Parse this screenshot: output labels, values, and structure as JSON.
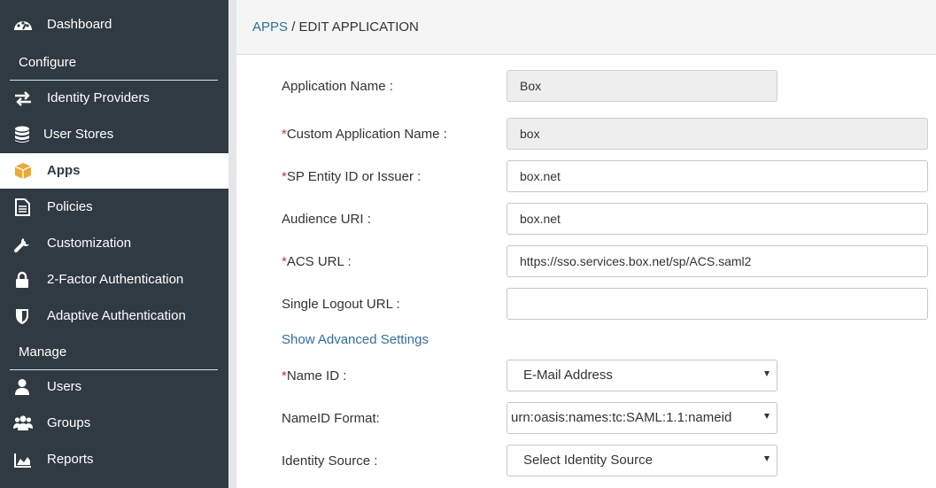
{
  "sidebar": {
    "items": [
      {
        "label": "Dashboard",
        "icon": "dashboard-icon"
      },
      {
        "label": "Identity Providers",
        "icon": "swap-arrows-icon"
      },
      {
        "label": "User Stores",
        "icon": "database-icon"
      },
      {
        "label": "Apps",
        "icon": "cube-icon"
      },
      {
        "label": "Policies",
        "icon": "document-icon"
      },
      {
        "label": "Customization",
        "icon": "wrench-icon"
      },
      {
        "label": "2-Factor Authentication",
        "icon": "lock-icon"
      },
      {
        "label": "Adaptive Authentication",
        "icon": "shield-icon"
      },
      {
        "label": "Users",
        "icon": "user-icon"
      },
      {
        "label": "Groups",
        "icon": "group-icon"
      },
      {
        "label": "Reports",
        "icon": "area-chart-icon"
      }
    ],
    "sections": {
      "configure": "Configure",
      "manage": "Manage"
    },
    "active": "Apps",
    "accent_color": "#f0a830"
  },
  "header": {
    "breadcrumb_link": "APPS",
    "breadcrumb_sep": " / ",
    "breadcrumb_current": "EDIT APPLICATION"
  },
  "form": {
    "required_mark": "*",
    "app_name": {
      "label": "Application Name :",
      "value": "Box"
    },
    "custom_app_name": {
      "label": "Custom Application Name :",
      "value": "box"
    },
    "sp_entity_id": {
      "label": "SP Entity ID or Issuer :",
      "value": "box.net"
    },
    "audience_uri": {
      "label": "Audience URI :",
      "value": "box.net"
    },
    "acs_url": {
      "label": "ACS URL :",
      "value": "https://sso.services.box.net/sp/ACS.saml2"
    },
    "single_logout_url": {
      "label": "Single Logout URL :",
      "value": ""
    },
    "show_advanced": "Show Advanced Settings",
    "name_id": {
      "label": "Name ID :",
      "value": "E-Mail Address"
    },
    "nameid_format": {
      "label": "NameID Format:",
      "value": "urn:oasis:names:tc:SAML:1.1:nameid"
    },
    "identity_source": {
      "label": "Identity Source :",
      "value": "Select Identity Source"
    }
  }
}
